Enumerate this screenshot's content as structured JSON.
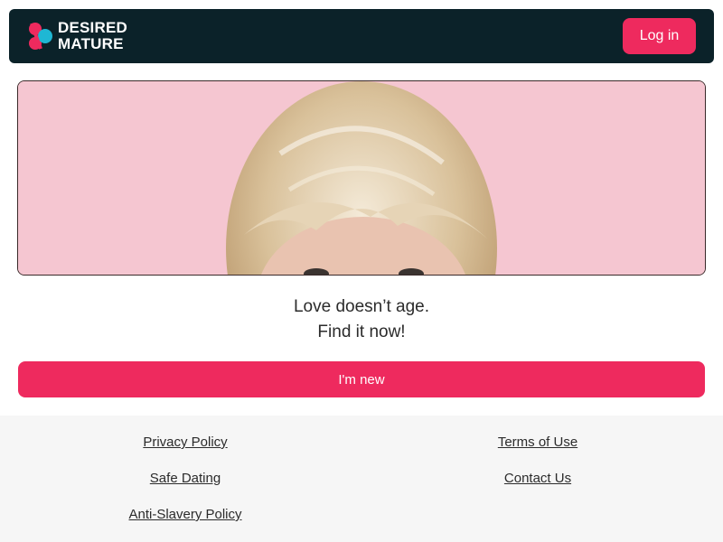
{
  "header": {
    "logo": {
      "line1": "DESIRED",
      "line2": "MATURE",
      "icon": "heart-pair-icon",
      "colors": [
        "#ee2a5e",
        "#1fb7d4"
      ]
    },
    "login_label": "Log in"
  },
  "hero": {
    "image": "portrait-of-blonde-short-haired-woman-on-pink-background"
  },
  "tagline": {
    "line1": "Love doesn’t age.",
    "line2": "Find it now!"
  },
  "cta": {
    "label": "I'm new"
  },
  "footer": {
    "left": [
      "Privacy Policy",
      "Safe Dating",
      "Anti-Slavery Policy"
    ],
    "right": [
      "Terms of Use",
      "Contact Us"
    ]
  },
  "colors": {
    "header_bg": "#0b2229",
    "accent": "#ee2a5e",
    "footer_bg": "#f6f6f6",
    "hero_bg": "#f5c6d1"
  }
}
